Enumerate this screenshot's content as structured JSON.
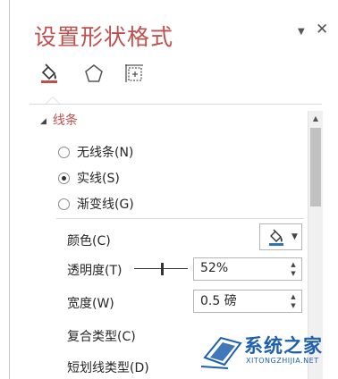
{
  "pane": {
    "title": "设置形状格式",
    "header_dropdown_icon": "triangle-down-icon",
    "close_icon": "close-x-icon"
  },
  "tabs": [
    {
      "icon": "paint-bucket-icon",
      "selected": true
    },
    {
      "icon": "pentagon-icon",
      "selected": false
    },
    {
      "icon": "size-layout-icon",
      "selected": false
    }
  ],
  "section": {
    "label": "线条",
    "expanded": true
  },
  "line_options": [
    {
      "label": "无线条(N)",
      "selected": false
    },
    {
      "label": "实线(S)",
      "selected": true
    },
    {
      "label": "渐变线(G)",
      "selected": false
    }
  ],
  "properties": {
    "color_label": "颜色(C)",
    "transparency_label": "透明度(T)",
    "transparency_value": "52%",
    "transparency_level": 0.52,
    "width_label": "宽度(W)",
    "width_value": "0.5 磅",
    "compound_type_label": "复合类型(C)",
    "dash_type_label": "短划线类型(D)"
  },
  "colors": {
    "accent": "#c0504d",
    "watermark_blue": "#1e5fae"
  },
  "watermark": {
    "text": "系统之家",
    "url": "XITONGZHIJIA.NET"
  }
}
